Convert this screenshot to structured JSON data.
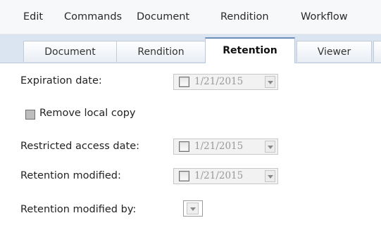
{
  "menubar": {
    "items": [
      {
        "label": "Edit"
      },
      {
        "label": "Commands"
      },
      {
        "label": "Document"
      },
      {
        "label": "Rendition"
      },
      {
        "label": "Workflow"
      }
    ]
  },
  "tabs": [
    {
      "label": "Document",
      "active": false
    },
    {
      "label": "Rendition",
      "active": false
    },
    {
      "label": "Retention",
      "active": true
    },
    {
      "label": "Viewer",
      "active": false
    },
    {
      "label": "",
      "active": false
    }
  ],
  "form": {
    "expiration_date": {
      "label": "Expiration date:",
      "value": "1/21/2015",
      "checked": false,
      "enabled": false
    },
    "remove_local_copy": {
      "label": "Remove local copy",
      "checked": false,
      "enabled": false
    },
    "restricted_access_date": {
      "label": "Restricted access date:",
      "value": "1/21/2015",
      "checked": false,
      "enabled": false
    },
    "retention_modified": {
      "label": "Retention modified:",
      "value": "1/21/2015",
      "checked": false,
      "enabled": false
    },
    "retention_modified_by": {
      "label": "Retention modified by:",
      "value": ""
    }
  },
  "icons": {
    "dropdown": "chevron-down-icon",
    "checkbox": "checkbox-icon"
  }
}
